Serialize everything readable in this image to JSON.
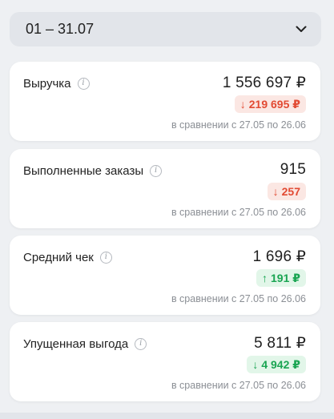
{
  "period": {
    "label": "01 – 31.07"
  },
  "cards": [
    {
      "title": "Выручка",
      "value": "1 556 697 ₽",
      "delta_arrow": "↓",
      "delta": "219 695 ₽",
      "compare": "в сравнении с 27.05 по 26.06"
    },
    {
      "title": "Выполненные заказы",
      "value": "915",
      "delta_arrow": "↓",
      "delta": "257",
      "compare": "в сравнении с 27.05 по 26.06"
    },
    {
      "title": "Средний чек",
      "value": "1 696 ₽",
      "delta_arrow": "↑",
      "delta": "191 ₽",
      "compare": "в сравнении с 27.05 по 26.06"
    },
    {
      "title": "Упущенная выгода",
      "value": "5 811 ₽",
      "delta_arrow": "↓",
      "delta": "4 942 ₽",
      "compare": "в сравнении с 27.05 по 26.06"
    }
  ],
  "colors": {
    "negative": "#e24a33",
    "positive": "#1aa552",
    "card_bg": "#ffffff",
    "page_bg": "#eef0f3"
  }
}
